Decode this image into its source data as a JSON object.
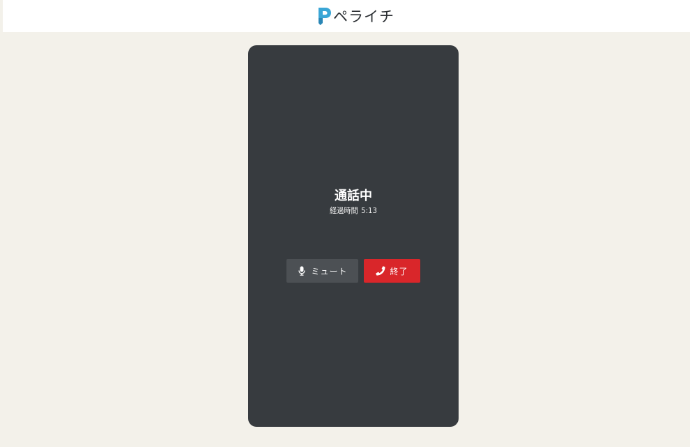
{
  "header": {
    "logo_text": "ペライチ",
    "logo_icon": "peraichi-logo-icon"
  },
  "call": {
    "status": "通話中",
    "elapsed_label": "経過時間",
    "elapsed_time": "5:13"
  },
  "actions": {
    "mute_label": "ミュート",
    "mute_icon": "microphone-icon",
    "end_label": "終了",
    "end_icon": "phone-icon"
  },
  "colors": {
    "background": "#f3f1ea",
    "panel": "#373b3f",
    "mute_button": "#4c5054",
    "end_button": "#d9262a",
    "logo_accent": "#3aa6d6"
  }
}
